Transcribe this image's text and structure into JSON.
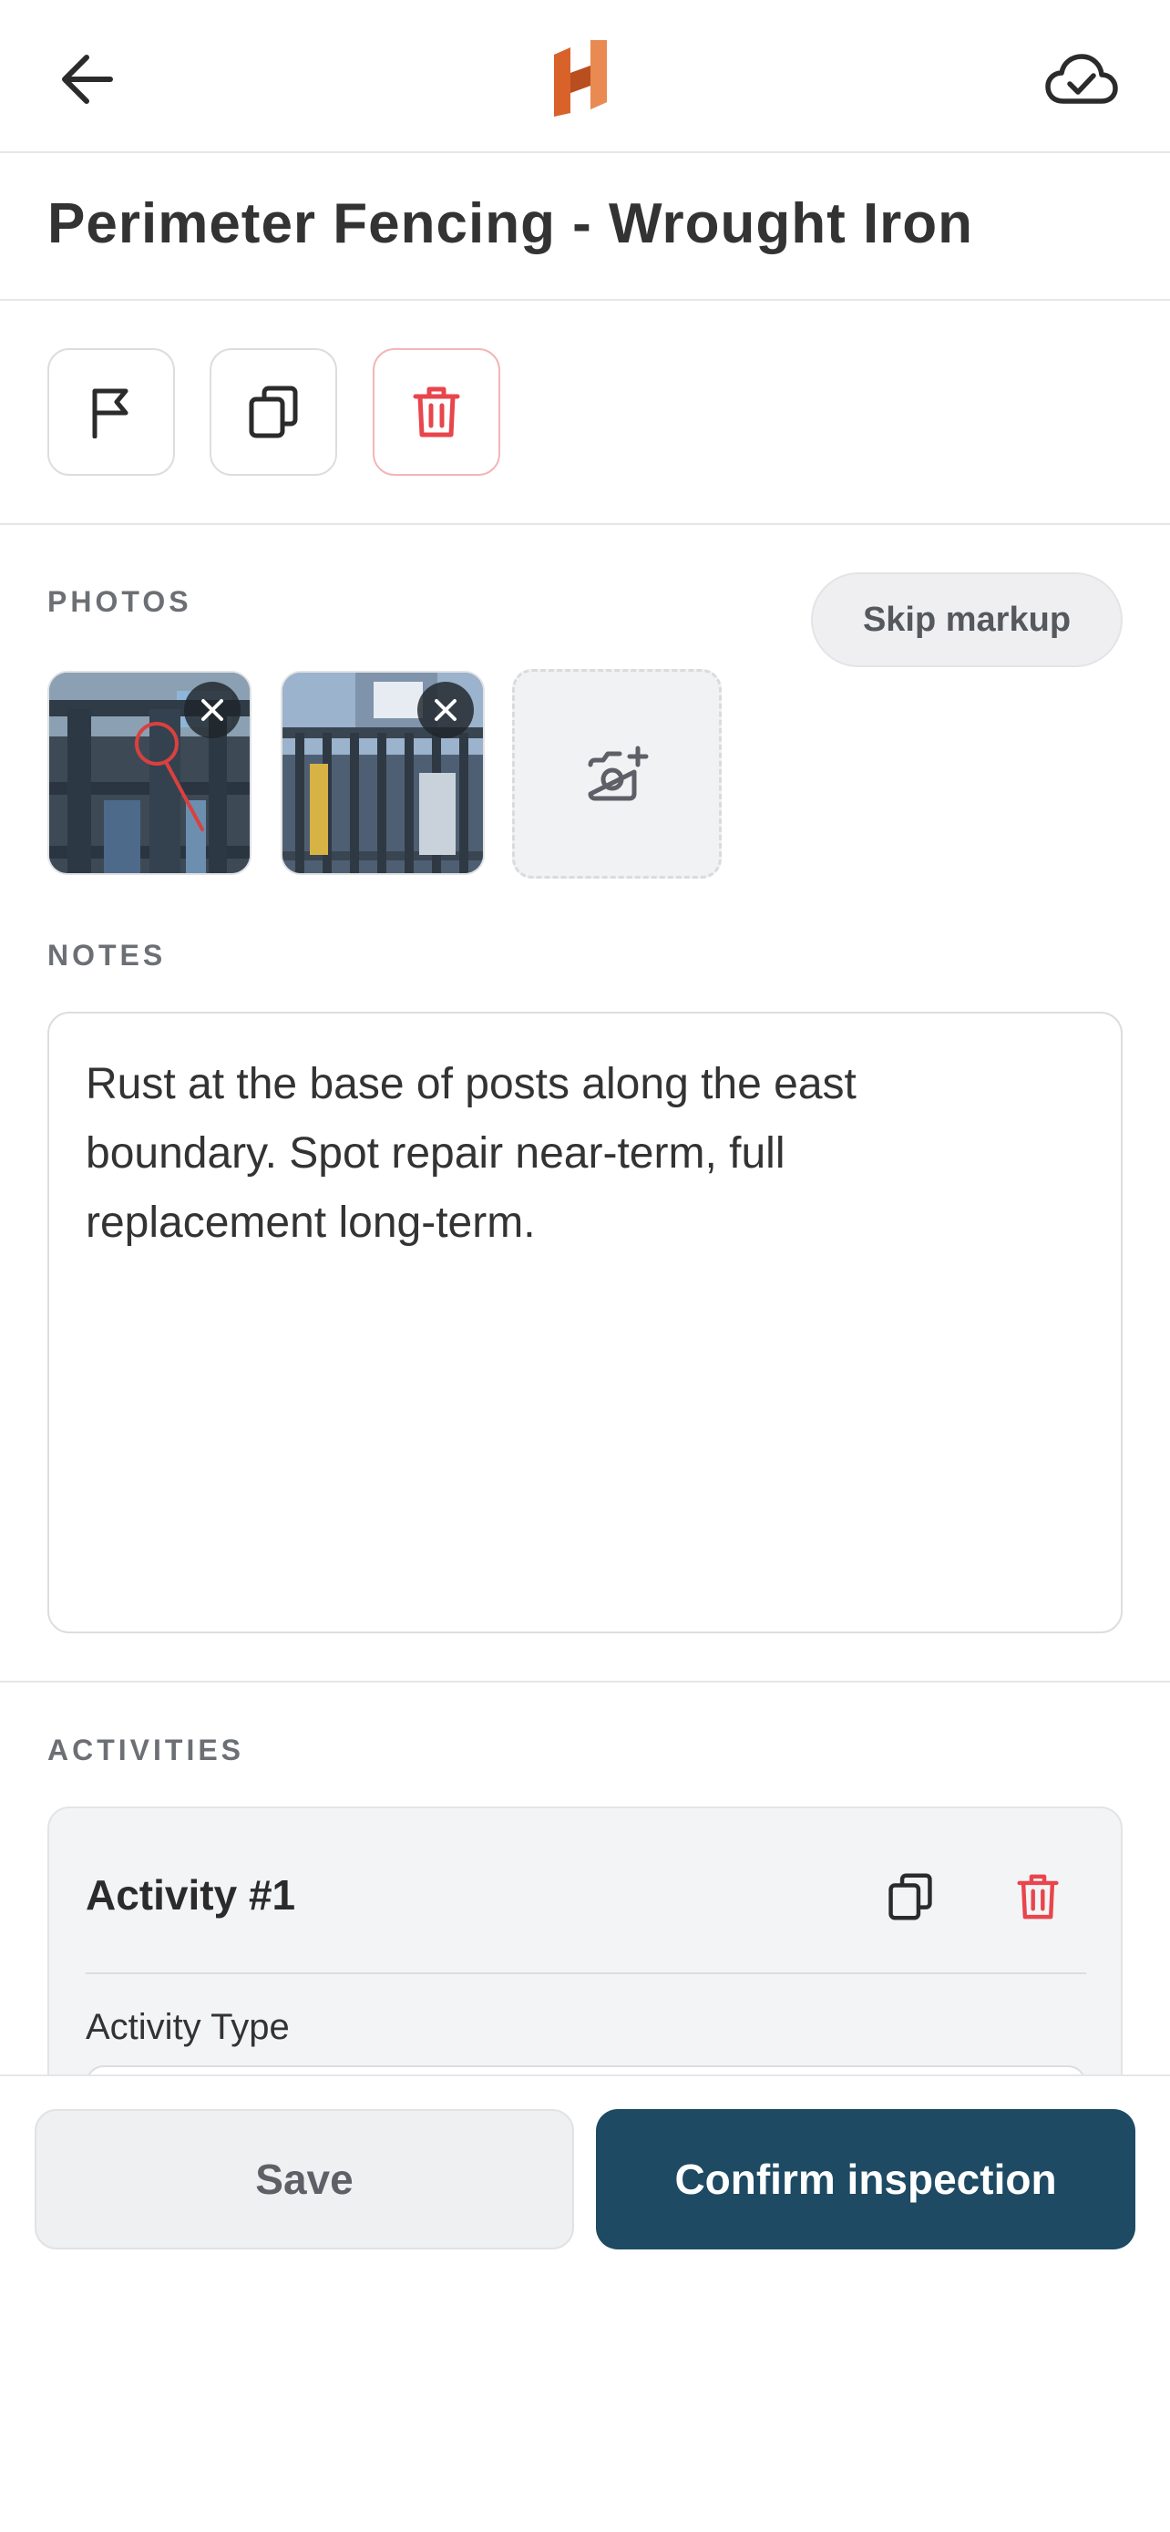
{
  "header": {
    "back_icon": "arrow-left-icon",
    "logo_icon": "brand-h-logo",
    "sync_icon": "cloud-check-icon"
  },
  "page": {
    "title": "Perimeter Fencing - Wrought Iron"
  },
  "actions": {
    "flag_icon": "flag-icon",
    "duplicate_icon": "copy-icon",
    "delete_icon": "trash-icon"
  },
  "photos": {
    "label": "PHOTOS",
    "skip_markup_label": "Skip markup",
    "items": [
      {
        "remove_icon": "close-icon"
      },
      {
        "remove_icon": "close-icon"
      }
    ],
    "add_icon": "camera-plus-icon"
  },
  "notes": {
    "label": "NOTES",
    "value": "Rust at the base of posts along the east boundary. Spot repair near-term, full replacement long-term."
  },
  "activities": {
    "label": "ACTIVITIES",
    "items": [
      {
        "title": "Activity #1",
        "type_label": "Activity Type"
      }
    ]
  },
  "footer": {
    "save_label": "Save",
    "confirm_label": "Confirm inspection"
  },
  "colors": {
    "brand_orange": "#d9622b",
    "primary": "#1e4a63",
    "danger": "#e8454c",
    "text": "#2b2b2b"
  }
}
